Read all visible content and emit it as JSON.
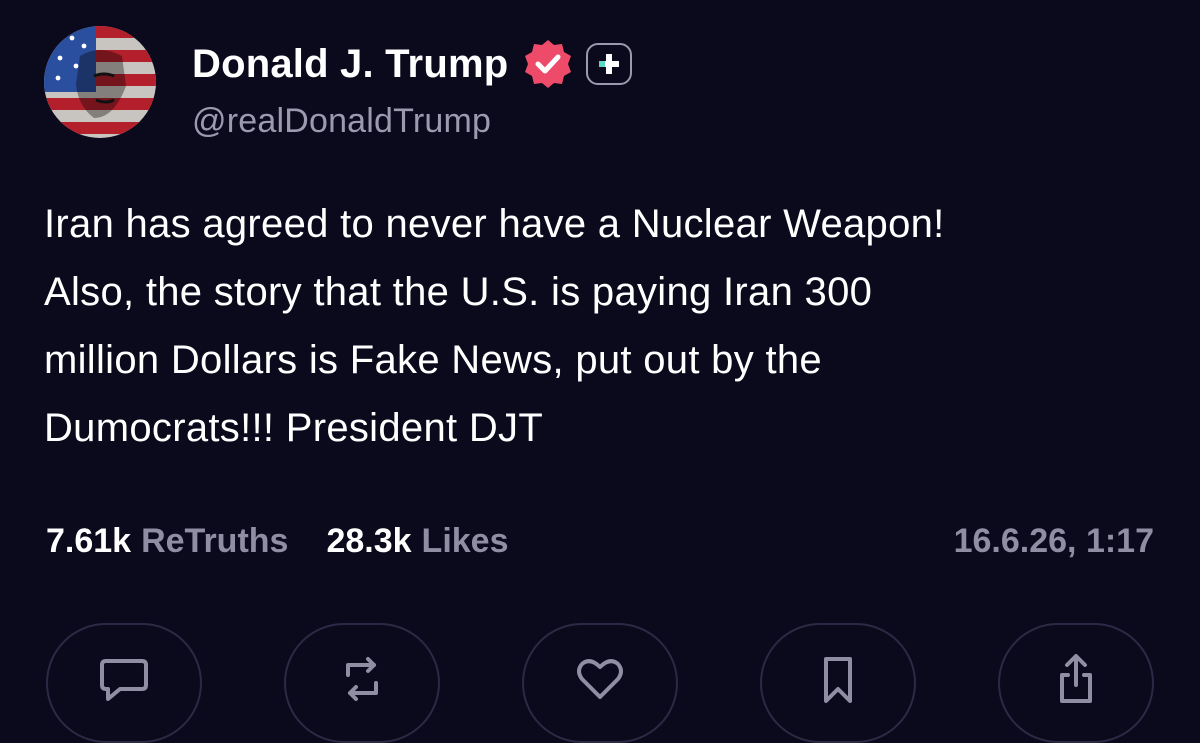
{
  "author": {
    "display_name": "Donald J. Trump",
    "handle": "@realDonaldTrump",
    "avatar": "avatar",
    "verified_icon": "verified-check-icon",
    "badge_icon": "plus-badge-icon",
    "verified_color": "#ee4b6a",
    "badge_color": "#5fd3c4"
  },
  "post": {
    "text": "Iran has agreed to never have a Nuclear Weapon!\nAlso, the story that the U.S. is paying Iran 300\nmillion Dollars is Fake News, put out by the\nDumocrats!!! President DJT"
  },
  "stats": {
    "retruths_count": "7.61k",
    "retruths_label": "ReTruths",
    "likes_count": "28.3k",
    "likes_label": "Likes",
    "timestamp": "16.6.26, 1:17"
  },
  "actions": [
    {
      "icon": "reply-icon"
    },
    {
      "icon": "retruth-icon"
    },
    {
      "icon": "like-icon"
    },
    {
      "icon": "bookmark-icon"
    },
    {
      "icon": "share-icon"
    }
  ],
  "colors": {
    "background": "#0b0a1c",
    "muted_text": "#8f8ea3",
    "button_border": "#2b2a45"
  }
}
